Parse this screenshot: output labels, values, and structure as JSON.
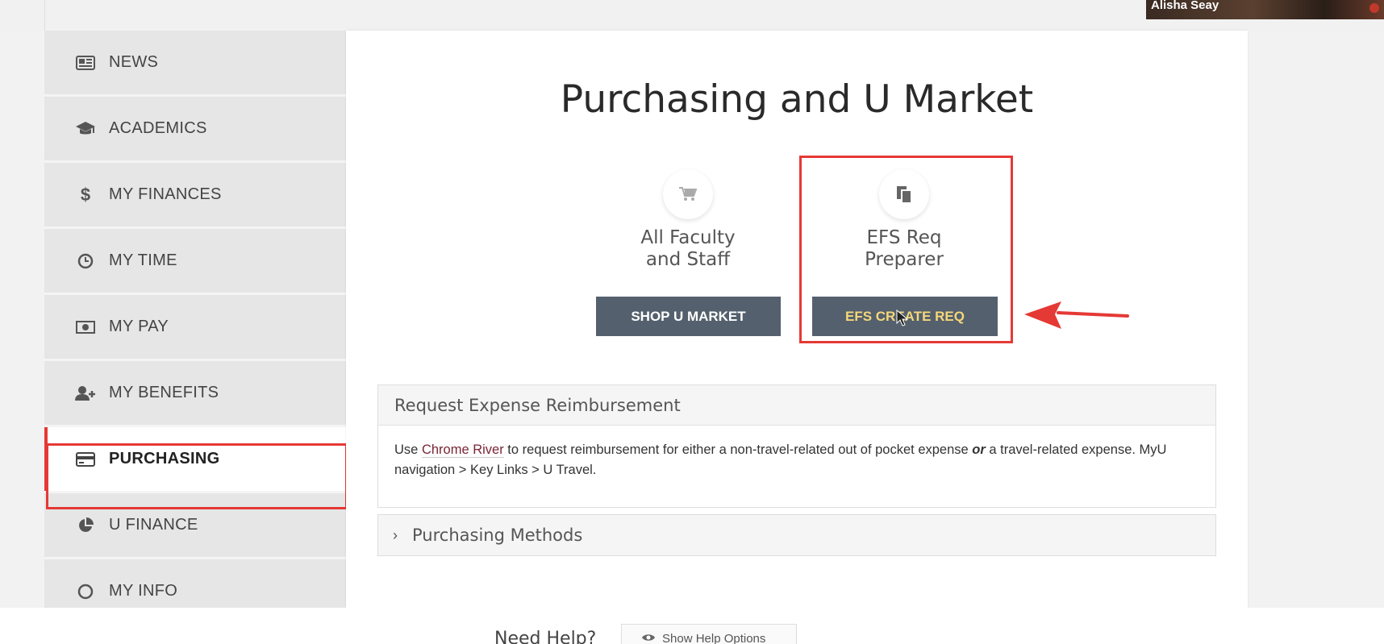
{
  "video": {
    "participant_name": "Alisha Seay"
  },
  "sidebar": {
    "items": [
      {
        "label": "NEWS",
        "icon": "newspaper-icon"
      },
      {
        "label": "ACADEMICS",
        "icon": "graduation-cap-icon"
      },
      {
        "label": "MY FINANCES",
        "icon": "dollar-icon"
      },
      {
        "label": "MY TIME",
        "icon": "clock-icon"
      },
      {
        "label": "MY PAY",
        "icon": "money-icon"
      },
      {
        "label": "MY BENEFITS",
        "icon": "user-plus-icon"
      },
      {
        "label": "PURCHASING",
        "icon": "credit-card-icon",
        "active": true
      },
      {
        "label": "U FINANCE",
        "icon": "pie-chart-icon"
      },
      {
        "label": "MY INFO",
        "icon": "info-icon"
      }
    ]
  },
  "main": {
    "title": "Purchasing and U Market",
    "tiles": [
      {
        "title": "All Faculty\nand Staff",
        "icon": "cart-icon",
        "button": "SHOP U MARKET"
      },
      {
        "title": "EFS Req\nPreparer",
        "icon": "documents-icon",
        "button": "EFS CREATE REQ"
      }
    ],
    "panel": {
      "header": "Request Expense Reimbursement",
      "body_before_link": "Use ",
      "link": "Chrome River",
      "body_after_link": " to request reimbursement for either a non-travel-related out of pocket expense ",
      "emph": "or",
      "body_end": " a travel-related expense. MyU navigation > Key Links > U Travel."
    },
    "collapse": {
      "label": "Purchasing Methods"
    }
  },
  "footer": {
    "need_help": "Need Help?",
    "help_button": "Show Help Options"
  },
  "colors": {
    "highlight": "#e53935",
    "button_bg": "#54606d",
    "efs_button_text": "#f5d77a",
    "link": "#7a2535"
  }
}
